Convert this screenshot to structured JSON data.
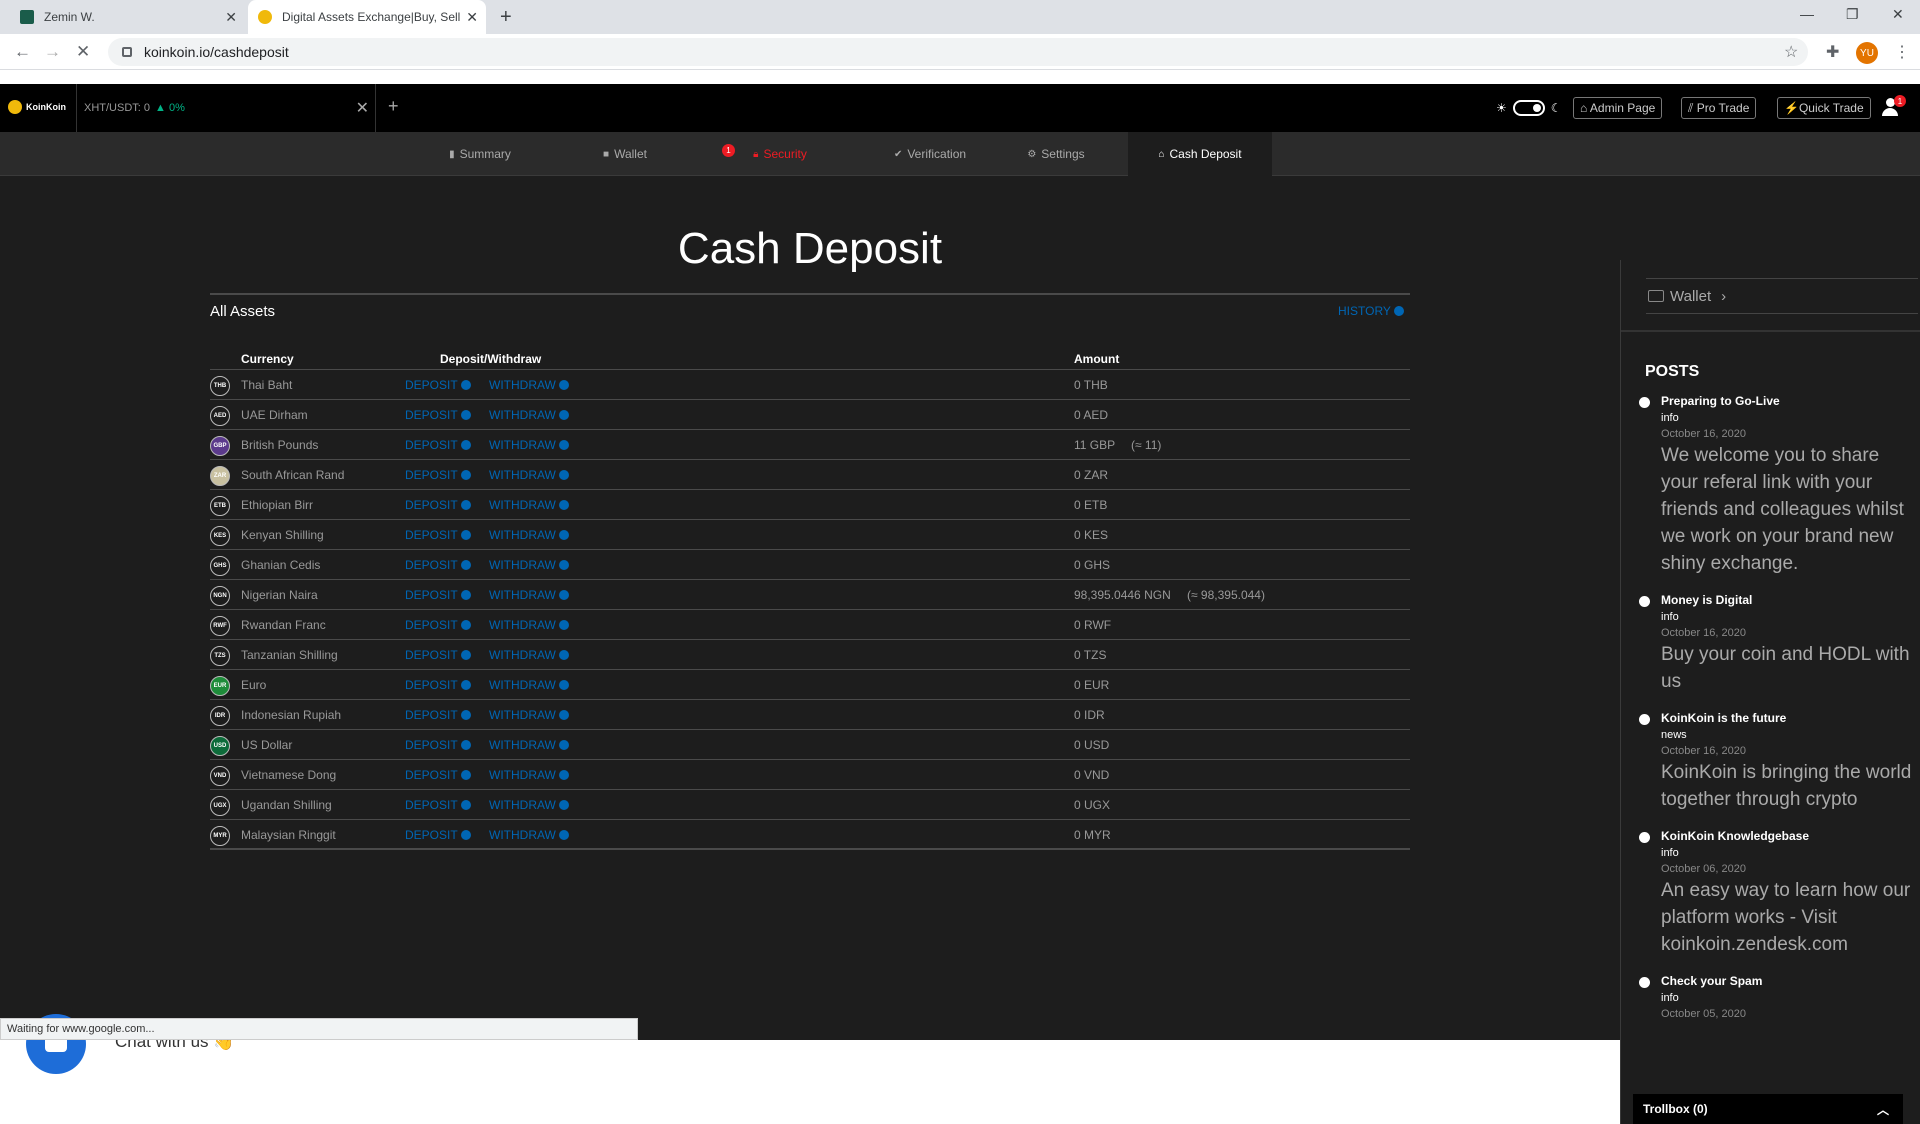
{
  "browser": {
    "tabs": [
      {
        "title": "Zemin W."
      },
      {
        "title": "Digital Assets Exchange|Buy, Sell"
      }
    ],
    "url": "koinkoin.io/cashdeposit",
    "profile_initials": "YU",
    "status_text": "Waiting for www.google.com..."
  },
  "topbar": {
    "logo_text": "KoinKoin",
    "pair": "XHT/USDT: 0",
    "pair_change": "0%",
    "admin_label": "Admin Page",
    "pro_label": "Pro Trade",
    "quick_label": "Quick Trade",
    "notification_count": "1"
  },
  "subnav": {
    "tabs": [
      {
        "label": "Summary",
        "icon": "chart-icon"
      },
      {
        "label": "Wallet",
        "icon": "wallet-icon"
      },
      {
        "label": "Security",
        "icon": "lock-icon"
      },
      {
        "label": "Verification",
        "icon": "check-icon"
      },
      {
        "label": "Settings",
        "icon": "gear-icon"
      },
      {
        "label": "Cash Deposit",
        "icon": "bank-icon"
      }
    ],
    "security_alert": "1"
  },
  "main": {
    "title": "Cash Deposit",
    "all_assets": "All Assets",
    "history": "HISTORY",
    "headers": {
      "currency": "Currency",
      "deposit_withdraw": "Deposit/Withdraw",
      "amount": "Amount"
    },
    "deposit_label": "DEPOSIT",
    "withdraw_label": "WITHDRAW",
    "rows": [
      {
        "code": "THB",
        "name": "Thai Baht",
        "amount": "0 THB",
        "approx": ""
      },
      {
        "code": "AED",
        "name": "UAE Dirham",
        "amount": "0 AED",
        "approx": ""
      },
      {
        "code": "GBP",
        "name": "British Pounds",
        "amount": "11 GBP",
        "approx": "(≈ 11)"
      },
      {
        "code": "ZAR",
        "name": "South African Rand",
        "amount": "0 ZAR",
        "approx": ""
      },
      {
        "code": "ETB",
        "name": "Ethiopian Birr",
        "amount": "0 ETB",
        "approx": ""
      },
      {
        "code": "KES",
        "name": "Kenyan Shilling",
        "amount": "0 KES",
        "approx": ""
      },
      {
        "code": "GHS",
        "name": "Ghanian Cedis",
        "amount": "0 GHS",
        "approx": ""
      },
      {
        "code": "NGN",
        "name": "Nigerian Naira",
        "amount": "98,395.0446 NGN",
        "approx": "(≈ 98,395.044)"
      },
      {
        "code": "RWF",
        "name": "Rwandan Franc",
        "amount": "0 RWF",
        "approx": ""
      },
      {
        "code": "TZS",
        "name": "Tanzanian Shilling",
        "amount": "0 TZS",
        "approx": ""
      },
      {
        "code": "EUR",
        "name": "Euro",
        "amount": "0 EUR",
        "approx": ""
      },
      {
        "code": "IDR",
        "name": "Indonesian Rupiah",
        "amount": "0 IDR",
        "approx": ""
      },
      {
        "code": "USD",
        "name": "US Dollar",
        "amount": "0 USD",
        "approx": ""
      },
      {
        "code": "VND",
        "name": "Vietnamese Dong",
        "amount": "0 VND",
        "approx": ""
      },
      {
        "code": "UGX",
        "name": "Ugandan Shilling",
        "amount": "0 UGX",
        "approx": ""
      },
      {
        "code": "MYR",
        "name": "Malaysian Ringgit",
        "amount": "0 MYR",
        "approx": ""
      }
    ],
    "badge_colors": {
      "GBP": "#5b3a8c",
      "ZAR": "#c8c0a0",
      "EUR": "#1e8c3a",
      "USD": "#0d6b3a"
    }
  },
  "chat": {
    "label": "Chat with us 👋"
  },
  "sidebar": {
    "wallet_label": "Wallet",
    "posts_title": "POSTS",
    "posts": [
      {
        "title": "Preparing to Go-Live",
        "category": "info",
        "date": "October 16, 2020",
        "body": "We welcome you to share your referal link with your friends and colleagues whilst we work on your brand new shiny exchange."
      },
      {
        "title": "Money is Digital",
        "category": "info",
        "date": "October 16, 2020",
        "body": "Buy your coin and HODL with us"
      },
      {
        "title": "KoinKoin is the future",
        "category": "news",
        "date": "October 16, 2020",
        "body": "KoinKoin is bringing the world together through crypto"
      },
      {
        "title": "KoinKoin Knowledgebase",
        "category": "info",
        "date": "October 06, 2020",
        "body": "An easy way to learn how our platform works - Visit koinkoin.zendesk.com"
      },
      {
        "title": "Check your Spam",
        "category": "info",
        "date": "October 05, 2020",
        "body": ""
      }
    ],
    "trollbox": "Trollbox (0)"
  },
  "colors": {
    "accent": "#0066b4",
    "alert": "#ed1c24",
    "positive": "#00b386"
  }
}
